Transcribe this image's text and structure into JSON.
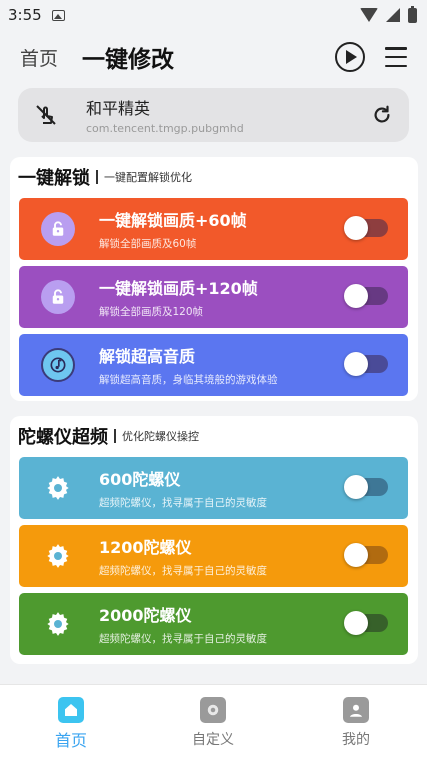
{
  "status_bar": {
    "time": "3:55"
  },
  "header": {
    "home_label": "首页",
    "title": "一键修改"
  },
  "app_card": {
    "name": "和平精英",
    "package": "com.tencent.tmgp.pubgmhd"
  },
  "sections": [
    {
      "title": "一键解锁",
      "subtitle": "一键配置解锁优化",
      "items": [
        {
          "title": "一键解锁画质+60帧",
          "subtitle": "解锁全部画质及60帧",
          "color": "#f2592a",
          "icon": "lock-icon",
          "enabled": false
        },
        {
          "title": "一键解锁画质+120帧",
          "subtitle": "解锁全部画质及120帧",
          "color": "#9b4fc0",
          "icon": "lock-icon",
          "enabled": false
        },
        {
          "title": "解锁超高音质",
          "subtitle": "解锁超高音质，身临其境般的游戏体验",
          "color": "#5b76f0",
          "icon": "music-note-icon",
          "enabled": false
        }
      ]
    },
    {
      "title": "陀螺仪超频",
      "subtitle": "优化陀螺仪操控",
      "items": [
        {
          "title": "600陀螺仪",
          "subtitle": "超频陀螺仪，找寻属于自己的灵敏度",
          "color": "#5ab3d3",
          "icon": "gear-icon",
          "enabled": false
        },
        {
          "title": "1200陀螺仪",
          "subtitle": "超频陀螺仪，找寻属于自己的灵敏度",
          "color": "#f59a0c",
          "icon": "gear-icon",
          "enabled": false
        },
        {
          "title": "2000陀螺仪",
          "subtitle": "超频陀螺仪，找寻属于自己的灵敏度",
          "color": "#4e9a2f",
          "icon": "gear-icon",
          "enabled": false
        }
      ]
    }
  ],
  "bottom_nav": [
    {
      "label": "首页",
      "icon": "home-icon",
      "active": true
    },
    {
      "label": "自定义",
      "icon": "custom-icon",
      "active": false
    },
    {
      "label": "我的",
      "icon": "user-icon",
      "active": false
    }
  ]
}
